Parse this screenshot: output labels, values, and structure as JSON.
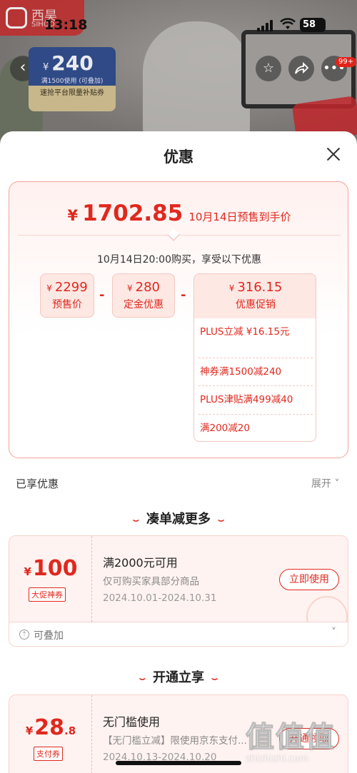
{
  "status_bar": {
    "time": "13:18",
    "battery": "58"
  },
  "brand": {
    "name": "西昊",
    "sub": "SIHOO"
  },
  "background_coupon": {
    "currency": "¥",
    "amount": "240",
    "condition": "满1500使用 (可叠加)",
    "title": "速抢平台限量补贴券"
  },
  "background_icons": [
    "back-icon",
    "star-icon",
    "share-icon",
    "more-icon"
  ],
  "notification_count": "99+",
  "sheet": {
    "title": "优惠"
  },
  "price_summary": {
    "currency": "¥",
    "final_price": "1702.85",
    "final_desc": "10月14日预售到手价",
    "buy_note": "10月14日20:00购买，享受以下优惠",
    "presale": {
      "value": "2299",
      "label": "预售价"
    },
    "deposit": {
      "value": "280",
      "label": "定金优惠"
    },
    "promo": {
      "value": "316.15",
      "label": "优惠促销"
    },
    "operators": [
      "-",
      "-"
    ],
    "promo_items": [
      "PLUS立减 ¥16.15元",
      "神券满1500减240",
      "PLUS津贴满499减40",
      "满200减20"
    ]
  },
  "enjoyed": {
    "label": "已享优惠",
    "expand": "展开"
  },
  "sections": [
    {
      "title": "凑单减更多"
    },
    {
      "title": "开通立享"
    }
  ],
  "coupons": [
    {
      "currency": "¥",
      "amount": "100",
      "decimal": "",
      "tag": "大促神券",
      "title": "满2000元可用",
      "desc": "仅可购买家具部分商品",
      "date": "2024.10.01-2024.10.31",
      "action": "立即使用",
      "stack_label": "可叠加"
    },
    {
      "currency": "¥",
      "amount": "28",
      "decimal": ".8",
      "tag": "支付券",
      "title": "无门槛使用",
      "desc": "【无门槛立减】限使用京东支付...",
      "date": "2024.10.13-2024.10.20",
      "action": "开通领取"
    }
  ],
  "watermark": {
    "logo": "值值值",
    "url": "zhizhizhi.com"
  },
  "colors": {
    "accent": "#e0281e",
    "card_bg": "#fff3f1",
    "border": "#f6c7bf"
  }
}
